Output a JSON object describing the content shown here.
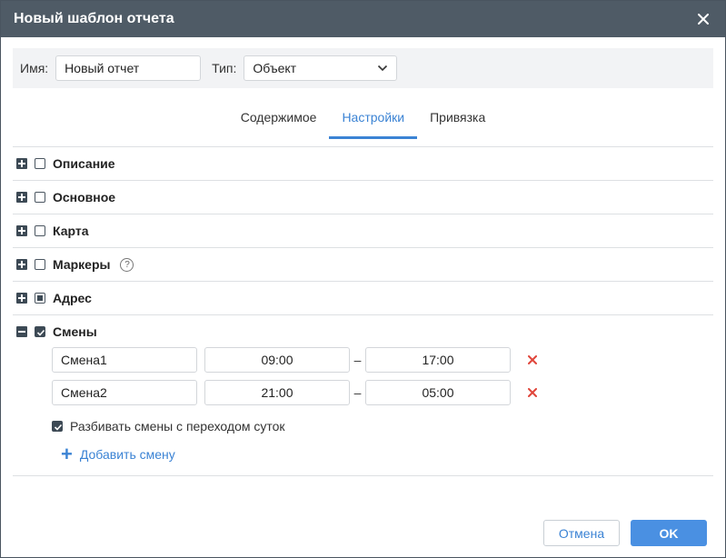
{
  "dialog": {
    "title": "Новый шаблон отчета",
    "close_icon": "close-icon"
  },
  "header": {
    "name_label": "Имя:",
    "name_value": "Новый отчет",
    "type_label": "Тип:",
    "type_value": "Объект"
  },
  "tabs": [
    {
      "label": "Содержимое",
      "active": false
    },
    {
      "label": "Настройки",
      "active": true
    },
    {
      "label": "Привязка",
      "active": false
    }
  ],
  "sections": [
    {
      "label": "Описание",
      "expanded": false,
      "state": "unchecked"
    },
    {
      "label": "Основное",
      "expanded": false,
      "state": "unchecked"
    },
    {
      "label": "Карта",
      "expanded": false,
      "state": "unchecked"
    },
    {
      "label": "Маркеры",
      "expanded": false,
      "state": "unchecked",
      "help": "?"
    },
    {
      "label": "Адрес",
      "expanded": false,
      "state": "partial"
    },
    {
      "label": "Смены",
      "expanded": true,
      "state": "checked"
    }
  ],
  "shifts": [
    {
      "name": "Смена1",
      "from": "09:00",
      "to": "17:00"
    },
    {
      "name": "Смена2",
      "from": "21:00",
      "to": "05:00"
    }
  ],
  "shift_separator": "–",
  "split_shifts": {
    "label": "Разбивать смены с переходом суток",
    "checked": true
  },
  "add_shift": {
    "label": "Добавить смену",
    "plus": "+"
  },
  "footer": {
    "cancel_label": "Отмена",
    "ok_label": "OK"
  },
  "colors": {
    "accent": "#3b83d4",
    "titlebar": "#4f5b66",
    "delete": "#e0453a"
  }
}
